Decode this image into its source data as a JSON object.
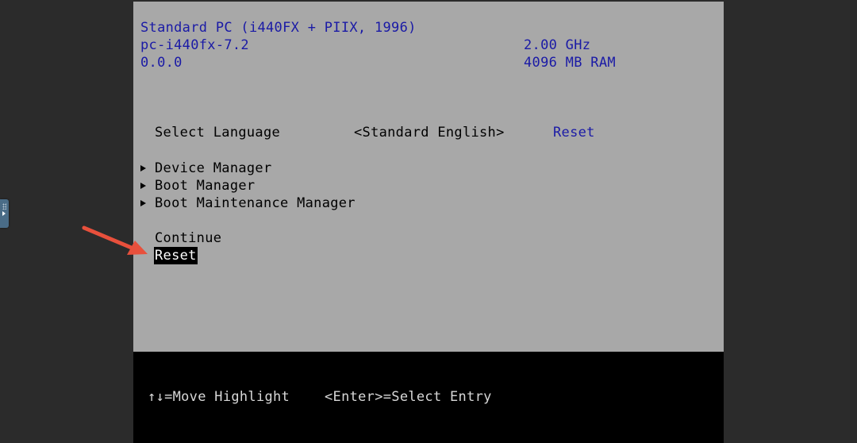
{
  "system_info": {
    "machine_name": "Standard PC (i440FX + PIIX, 1996)",
    "machine_type": "pc-i440fx-7.2",
    "version": "0.0.0",
    "cpu_speed": "2.00 GHz",
    "memory": "4096 MB RAM"
  },
  "language_row": {
    "label": "Select Language",
    "value": "<Standard English>",
    "help": "Reset"
  },
  "menu": {
    "submenus": [
      {
        "label": "Device Manager"
      },
      {
        "label": "Boot Manager"
      },
      {
        "label": "Boot Maintenance Manager"
      }
    ],
    "actions": [
      {
        "label": "Continue"
      },
      {
        "label": "Reset",
        "selected": true
      }
    ]
  },
  "footer": {
    "move_hint": "↑↓=Move Highlight",
    "enter_hint": "<Enter>=Select Entry"
  },
  "colors": {
    "panel_bg": "#a8a8a8",
    "info_text": "#1a1aa6",
    "annotation_arrow": "#e8503c"
  }
}
